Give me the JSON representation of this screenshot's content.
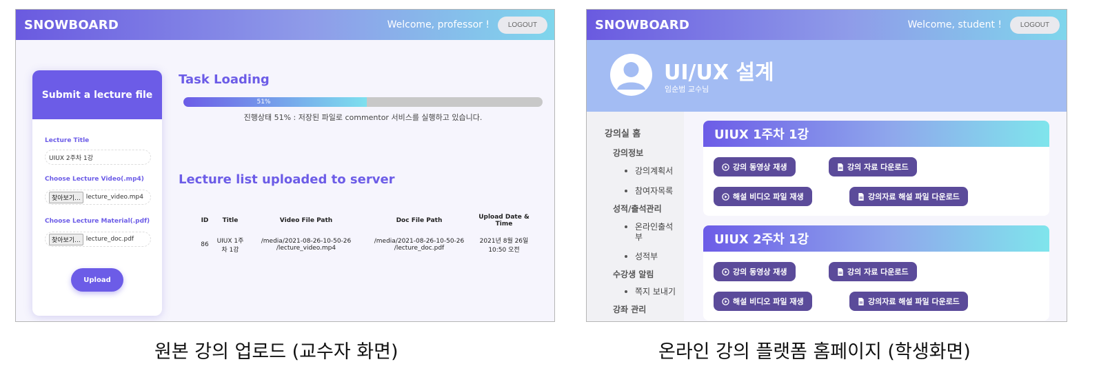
{
  "left": {
    "brand": "SNOWBOARD",
    "welcome": "Welcome, professor !",
    "logout": "LOGOUT",
    "submit_title": "Submit a lecture file",
    "lecture_title_label": "Lecture Title",
    "lecture_title_value": "UIUX 2주차 1강",
    "video_label": "Choose Lecture Video(.mp4)",
    "file_button": "찾아보기...",
    "video_file": "lecture_video.mp4",
    "doc_label": "Choose Lecture Material(.pdf)",
    "doc_file": "lecture_doc.pdf",
    "upload": "Upload",
    "task_title": "Task Loading",
    "progress_label": "51%",
    "progress_value": 0.51,
    "progress_status": "진행상태 51% : 저장된 파일로 commentor 서비스를 실행하고 있습니다.",
    "list_title": "Lecture list uploaded to server",
    "table": {
      "headers": [
        "ID",
        "Title",
        "Video File Path",
        "Doc File Path",
        "Upload Date & Time"
      ],
      "rows": [
        [
          "86",
          "UIUX 1주차 1강",
          "/media/2021-08-26-10-50-26 /lecture_video.mp4",
          "/media/2021-08-26-10-50-26 /lecture_doc.pdf",
          "2021년 8월 26일 10:50 오전"
        ]
      ]
    }
  },
  "right": {
    "brand": "SNOWBOARD",
    "welcome": "Welcome, student !",
    "logout": "LOGOUT",
    "course_title": "UI/UX 설계",
    "professor": "임순범 교수님",
    "sidebar": {
      "home": "강의실 홈",
      "info": "강의정보",
      "plan": "강의계획서",
      "refs": "참여자목록",
      "grades": "성적/출석관리",
      "attend_line1": "온라인출석",
      "attend_line2": "부",
      "gradebook": "성적부",
      "notices": "수강생 알림",
      "message": "쪽지 보내기",
      "manage": "강좌 관리"
    },
    "lessons": [
      {
        "title": "UIUX 1주차 1강",
        "buttons": [
          "강의 동영상 재생",
          "강의 자료 다운로드",
          "해설 비디오 파일 재생",
          "강의자료 해설 파일 다운로드"
        ]
      },
      {
        "title": "UIUX 2주차 1강",
        "buttons": [
          "강의 동영상 재생",
          "강의 자료 다운로드",
          "해설 비디오 파일 재생",
          "강의자료 해설 파일 다운로드"
        ]
      }
    ]
  },
  "captions": {
    "left": "원본 강의 업로드 (교수자 화면)",
    "right": "온라인 강의 플랫폼 홈페이지 (학생화면)"
  }
}
